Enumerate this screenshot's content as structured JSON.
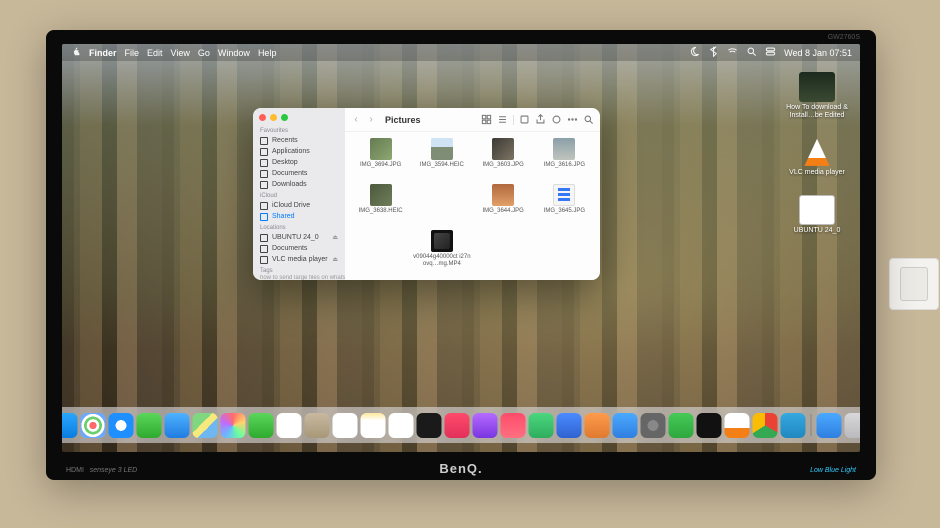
{
  "monitor": {
    "model": "GW2760S",
    "brand": "BenQ.",
    "hdmi": "HDMI",
    "senseye": "senseye 3  LED",
    "low_blue": "Low Blue Light"
  },
  "menubar": {
    "app": "Finder",
    "items": [
      "File",
      "Edit",
      "View",
      "Go",
      "Window",
      "Help"
    ],
    "datetime": "Wed 8 Jan  07:51"
  },
  "desktop": {
    "items": [
      {
        "label": "How To download & Install…be Edited"
      },
      {
        "label": "VLC media player"
      },
      {
        "label": "UBUNTU 24_0"
      }
    ]
  },
  "finder": {
    "title": "Pictures",
    "sidebar": {
      "favourites_label": "Favourites",
      "favourites": [
        "Recents",
        "Applications",
        "Desktop",
        "Documents",
        "Downloads"
      ],
      "icloud_label": "iCloud",
      "icloud": [
        "iCloud Drive",
        "Shared"
      ],
      "locations_label": "Locations",
      "locations": [
        "UBUNTU 24_0",
        "Documents",
        "VLC media player"
      ],
      "tags_label": "Tags",
      "tag_hint": "how to send large files on whatsapp"
    },
    "files": [
      {
        "name": "IMG_3694.JPG",
        "cls": "photo1"
      },
      {
        "name": "IMG_3594.HEIC",
        "cls": "photo2"
      },
      {
        "name": "IMG_3603.JPG",
        "cls": "photo3"
      },
      {
        "name": "IMG_3616.JPG",
        "cls": "photo4"
      },
      {
        "name": "IMG_3638.HEIC",
        "cls": "photo5"
      },
      {
        "name": "",
        "cls": "blank"
      },
      {
        "name": "IMG_3644.JPG",
        "cls": "photo6"
      },
      {
        "name": "IMG_3645.JPG",
        "cls": "photo7"
      },
      {
        "name": "",
        "cls": "blank"
      },
      {
        "name": "v09044g40000ct i27novq…mg.MP4",
        "cls": "video"
      }
    ]
  },
  "dock": {
    "items": [
      {
        "name": "finder",
        "color": "linear-gradient(#2aa6ff,#0a7de0)"
      },
      {
        "name": "launchpad",
        "color": "radial-gradient(circle,#ff6b6b 20%,#fff 21%,#fff 35%,#6bcf6b 36%,#6bcf6b 50%,#fff 51%,#fff 65%,#6ba9ff 66%)"
      },
      {
        "name": "safari",
        "color": "radial-gradient(circle at 50% 50%,#fff 30%,#1e8fff 31%)"
      },
      {
        "name": "messages",
        "color": "linear-gradient(#5bd65b,#2eab2e)"
      },
      {
        "name": "mail",
        "color": "linear-gradient(#4fb2ff,#1f7ce0)"
      },
      {
        "name": "maps",
        "color": "linear-gradient(135deg,#7fd87f 40%,#f7e97c 40%,#f7e97c 60%,#6fb7f0 60%)"
      },
      {
        "name": "photos",
        "color": "conic-gradient(#ff6b6b,#ffd36b,#6bff9e,#6bb7ff,#c06bff,#ff6b6b)"
      },
      {
        "name": "facetime",
        "color": "linear-gradient(#5bd65b,#2eab2e)"
      },
      {
        "name": "calendar",
        "color": "linear-gradient(#fff 70%,#fff 70%)"
      },
      {
        "name": "contacts",
        "color": "linear-gradient(#c8b8a0,#a89878)"
      },
      {
        "name": "reminders",
        "color": "#fff"
      },
      {
        "name": "notes",
        "color": "linear-gradient(#ffe79b,#fff 30%)"
      },
      {
        "name": "freeform",
        "color": "#fff"
      },
      {
        "name": "tv",
        "color": "#1a1a1a"
      },
      {
        "name": "music",
        "color": "linear-gradient(#ff4b6b,#e2305a)"
      },
      {
        "name": "podcasts",
        "color": "linear-gradient(#b56bff,#7a35e0)"
      },
      {
        "name": "news",
        "color": "linear-gradient(#ff4b6b,#ff7080)"
      },
      {
        "name": "numbers",
        "color": "linear-gradient(#4bd67f,#2fae5e)"
      },
      {
        "name": "keynote",
        "color": "linear-gradient(#4b8bff,#2f62d0)"
      },
      {
        "name": "pages",
        "color": "linear-gradient(#ff9b4b,#e07a2f)"
      },
      {
        "name": "appstore",
        "color": "linear-gradient(#4ba9ff,#2f7fe0)"
      },
      {
        "name": "settings",
        "color": "radial-gradient(circle,#888 30%,#666 31%)"
      },
      {
        "name": "whatsapp",
        "color": "linear-gradient(#45c957,#2ea83e)"
      },
      {
        "name": "capcut",
        "color": "#111"
      },
      {
        "name": "vlc",
        "color": "linear-gradient(#fff 60%,#f57f17 60%)"
      },
      {
        "name": "chrome",
        "color": "conic-gradient(#ea4335 0 33%,#34a853 33% 66%,#fbbc05 66% 100%)"
      },
      {
        "name": "telegram",
        "color": "linear-gradient(#36a8e0,#2187c0)"
      }
    ],
    "right": [
      {
        "name": "downloads",
        "color": "linear-gradient(#4ba9ff,#2f7fe0)"
      },
      {
        "name": "trash",
        "color": "linear-gradient(#d8d8db,#bababd)"
      }
    ]
  }
}
